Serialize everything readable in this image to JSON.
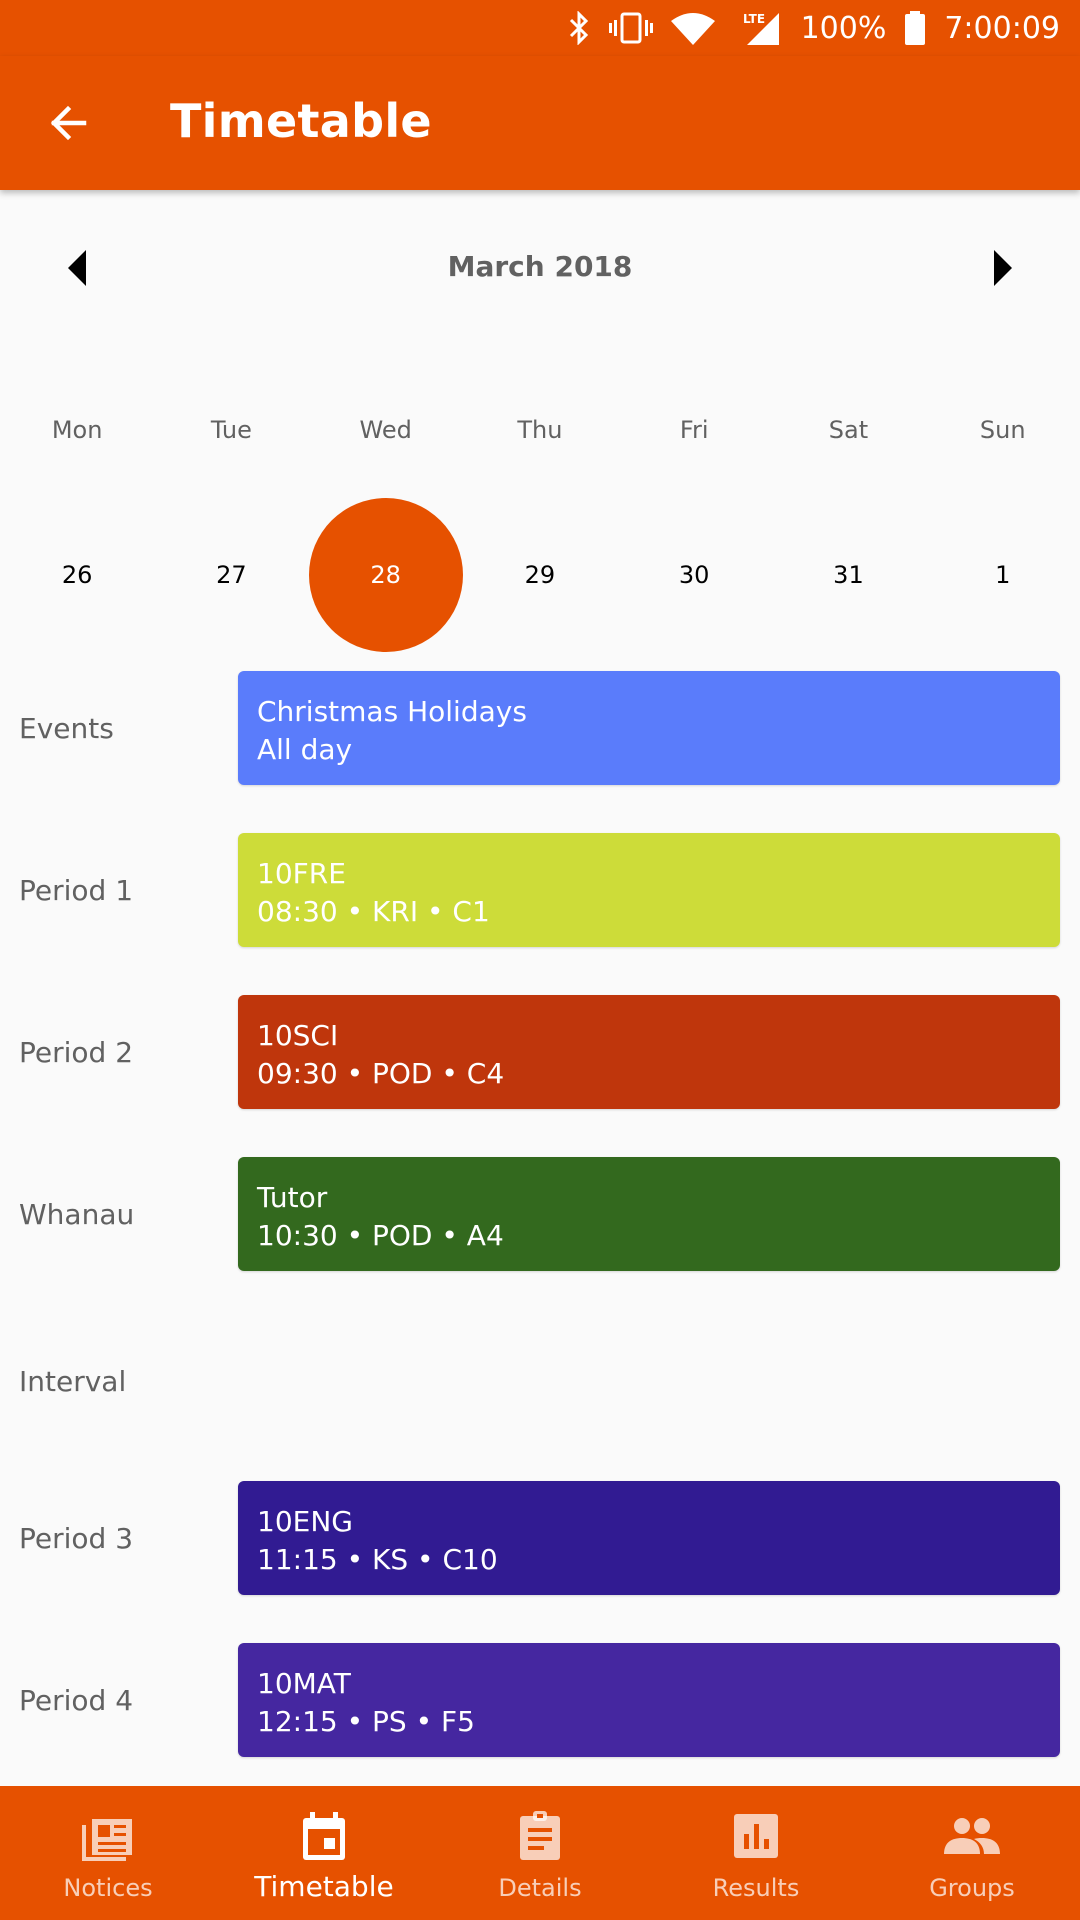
{
  "status_bar": {
    "battery": "100%",
    "time": "7:00:09",
    "icons": [
      "bluetooth-icon",
      "vibrate-icon",
      "wifi-icon",
      "lte-signal-icon",
      "battery-icon"
    ]
  },
  "app_bar": {
    "title": "Timetable",
    "back_icon": "arrow-back-icon"
  },
  "calendar": {
    "month": "March 2018",
    "weekdays": [
      "Mon",
      "Tue",
      "Wed",
      "Thu",
      "Fri",
      "Sat",
      "Sun"
    ],
    "days": [
      "26",
      "27",
      "28",
      "29",
      "30",
      "31",
      "1"
    ],
    "selected_day": "28",
    "accent_color": "#e65100"
  },
  "schedule": [
    {
      "label": "Events",
      "title": "Christmas Holidays",
      "detail": "All day",
      "color": "#5a7cfb"
    },
    {
      "label": "Period 1",
      "title": "10FRE",
      "detail": "08:30 • KRI • C1",
      "color": "#cddc39"
    },
    {
      "label": "Period 2",
      "title": "10SCI",
      "detail": "09:30 • POD • C4",
      "color": "#bf360c"
    },
    {
      "label": "Whanau",
      "title": "Tutor",
      "detail": "10:30 • POD • A4",
      "color": "#33691e"
    },
    {
      "label": "Interval",
      "title": "",
      "detail": "",
      "color": ""
    },
    {
      "label": "Period 3",
      "title": "10ENG",
      "detail": "11:15 • KS • C10",
      "color": "#311b92"
    },
    {
      "label": "Period 4",
      "title": "10MAT",
      "detail": "12:15 • PS • F5",
      "color": "#4527a0"
    }
  ],
  "bottom_nav": {
    "items": [
      {
        "label": "Notices",
        "icon": "newspaper-icon"
      },
      {
        "label": "Timetable",
        "icon": "calendar-icon"
      },
      {
        "label": "Details",
        "icon": "clipboard-icon"
      },
      {
        "label": "Results",
        "icon": "bar-chart-icon"
      },
      {
        "label": "Groups",
        "icon": "people-icon"
      }
    ],
    "active": "Timetable",
    "background": "#e65100"
  }
}
